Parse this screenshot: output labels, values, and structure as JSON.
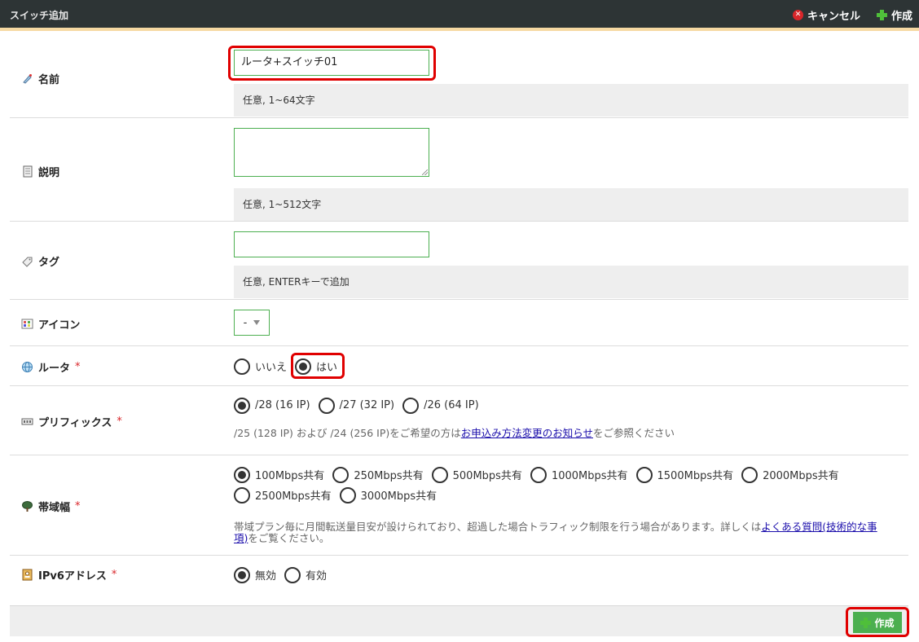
{
  "header": {
    "title": "スイッチ追加",
    "cancel_label": "キャンセル",
    "create_label": "作成"
  },
  "fields": {
    "name": {
      "label": "名前",
      "value": "ルータ+スイッチ01",
      "hint": "任意, 1~64文字"
    },
    "description": {
      "label": "説明",
      "value": "",
      "hint": "任意, 1~512文字"
    },
    "tag": {
      "label": "タグ",
      "value": "",
      "hint": "任意, ENTERキーで追加"
    },
    "icon": {
      "label": "アイコン",
      "selected": "-"
    },
    "router": {
      "label": "ルータ",
      "required_mark": "*",
      "options": [
        "いいえ",
        "はい"
      ],
      "selected": "はい"
    },
    "prefix": {
      "label": "プリフィックス",
      "required_mark": "*",
      "options": [
        "/28 (16 IP)",
        "/27 (32 IP)",
        "/26 (64 IP)"
      ],
      "selected": "/28 (16 IP)",
      "note_before": "/25 (128 IP) および /24 (256 IP)をご希望の方は",
      "note_link": "お申込み方法変更のお知らせ",
      "note_after": "をご参照ください"
    },
    "bandwidth": {
      "label": "帯域幅",
      "required_mark": "*",
      "options": [
        "100Mbps共有",
        "250Mbps共有",
        "500Mbps共有",
        "1000Mbps共有",
        "1500Mbps共有",
        "2000Mbps共有",
        "2500Mbps共有",
        "3000Mbps共有"
      ],
      "selected": "100Mbps共有",
      "note_before": "帯域プラン毎に月間転送量目安が設けられており、超過した場合トラフィック制限を行う場合があります。詳しくは",
      "note_link_a": "よくある質問(技術的な事",
      "note_link_b": "項)",
      "note_after": "をご覧ください。"
    },
    "ipv6": {
      "label": "IPv6アドレス",
      "required_mark": "*",
      "options": [
        "無効",
        "有効"
      ],
      "selected": "無効"
    }
  },
  "footer": {
    "create_label": "作成"
  },
  "colors": {
    "accent_green": "#4caf50",
    "highlight_red": "#e00000",
    "header_bg": "#2d3435"
  }
}
